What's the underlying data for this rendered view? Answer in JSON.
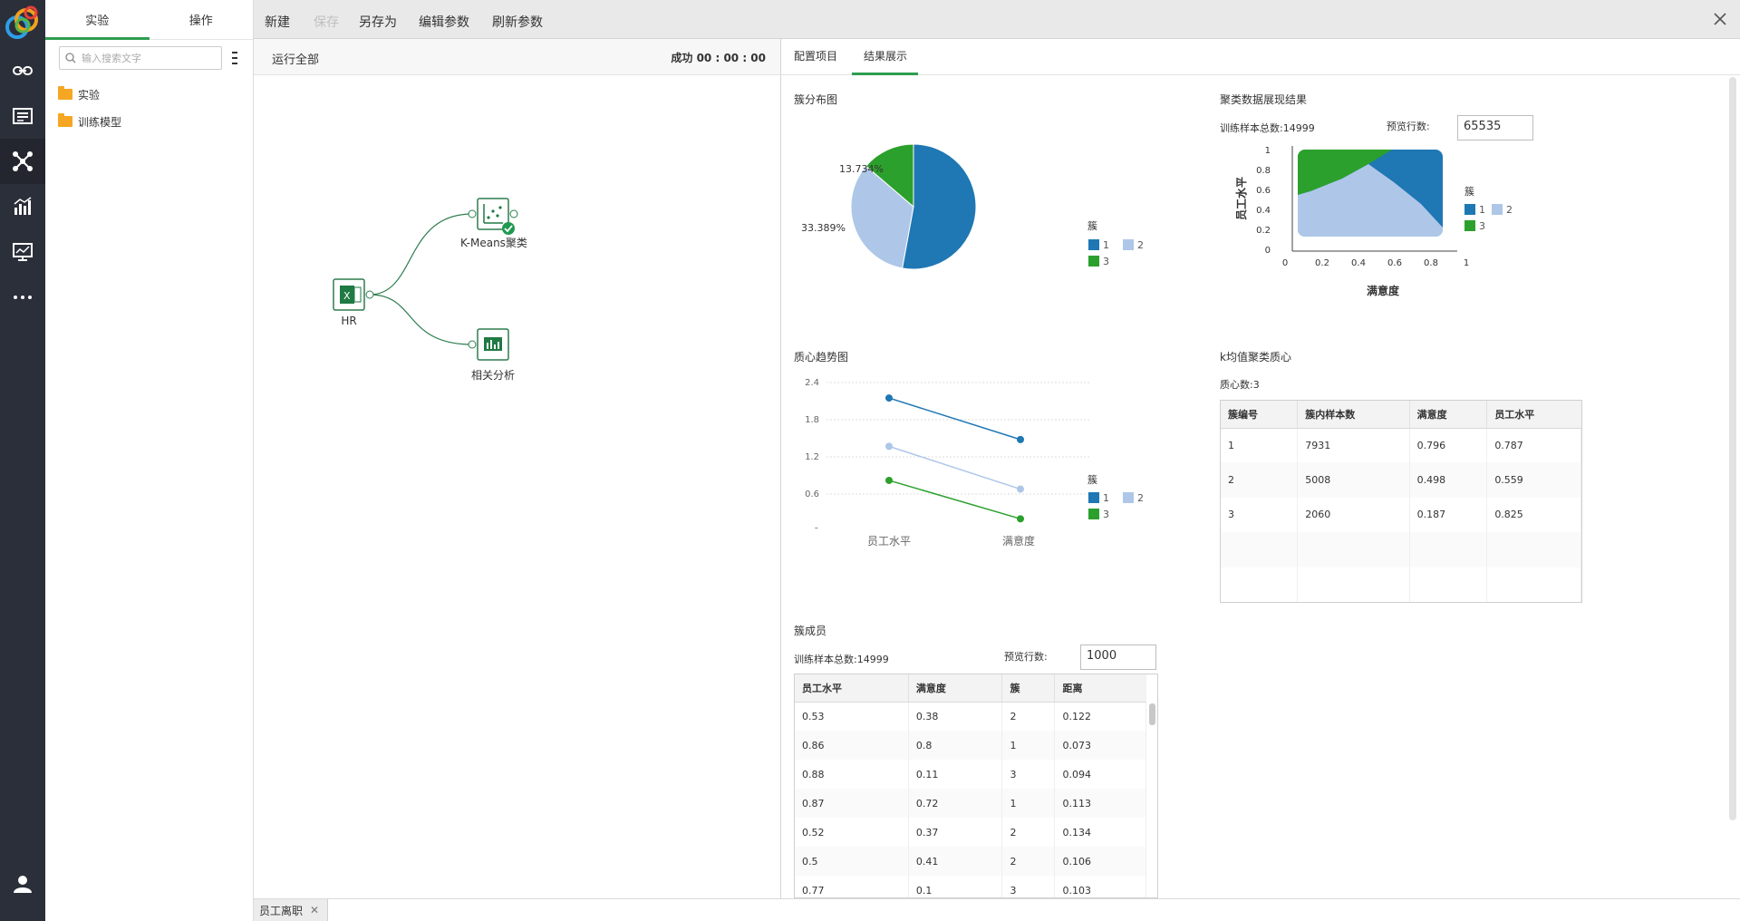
{
  "explorer": {
    "tabs": [
      {
        "label": "实验"
      },
      {
        "label": "操作"
      }
    ],
    "search_placeholder": "输入搜索文字",
    "tree": [
      {
        "label": "实验"
      },
      {
        "label": "训练模型"
      }
    ]
  },
  "toolbar": {
    "new": "新建",
    "save": "保存",
    "save_as": "另存为",
    "edit_params": "编辑参数",
    "refresh_params": "刷新参数"
  },
  "flow": {
    "run_all": "运行全部",
    "status": "成功 00 : 00 : 00",
    "nodes": {
      "hr": "HR",
      "kmeans": "K-Means聚类",
      "corr": "相关分析"
    }
  },
  "results": {
    "tabs": [
      {
        "label": "配置项目"
      },
      {
        "label": "结果展示"
      }
    ],
    "pie": {
      "title": "簇分布图",
      "label_a": "13.734%",
      "label_b": "33.389%",
      "legend_title": "簇",
      "legend": [
        "1",
        "2",
        "3"
      ]
    },
    "scatter": {
      "title": "聚类数据展现结果",
      "samples": "训练样本总数:14999",
      "preview_label": "预览行数:",
      "preview_value": "65535",
      "ylabel": "员工水平",
      "xlabel": "满意度",
      "yticks": [
        "1",
        "0.8",
        "0.6",
        "0.4",
        "0.2",
        "0"
      ],
      "xticks": [
        "0",
        "0.2",
        "0.4",
        "0.6",
        "0.8",
        "1"
      ],
      "legend_title": "簇",
      "legend": [
        "1",
        "2",
        "3"
      ]
    },
    "trend": {
      "title": "质心趋势图",
      "yticks": [
        "2.4",
        "1.8",
        "1.2",
        "0.6",
        "0"
      ],
      "xticks": [
        "员工水平",
        "满意度"
      ],
      "legend_title": "簇",
      "legend": [
        "1",
        "2",
        "3"
      ]
    },
    "centroids": {
      "title": "k均值聚类质心",
      "count": "质心数:3",
      "headers": [
        "簇编号",
        "簇内样本数",
        "满意度",
        "员工水平"
      ],
      "rows": [
        [
          "1",
          "7931",
          "0.796",
          "0.787"
        ],
        [
          "2",
          "5008",
          "0.498",
          "0.559"
        ],
        [
          "3",
          "2060",
          "0.187",
          "0.825"
        ]
      ]
    },
    "members": {
      "title": "簇成员",
      "samples": "训练样本总数:14999",
      "preview_label": "预览行数:",
      "preview_value": "1000",
      "headers": [
        "员工水平",
        "满意度",
        "簇",
        "距离"
      ],
      "rows": [
        [
          "0.53",
          "0.38",
          "2",
          "0.122"
        ],
        [
          "0.86",
          "0.8",
          "1",
          "0.073"
        ],
        [
          "0.88",
          "0.11",
          "3",
          "0.094"
        ],
        [
          "0.87",
          "0.72",
          "1",
          "0.113"
        ],
        [
          "0.52",
          "0.37",
          "2",
          "0.134"
        ],
        [
          "0.5",
          "0.41",
          "2",
          "0.106"
        ],
        [
          "0.77",
          "0.1",
          "3",
          "0.103"
        ]
      ]
    }
  },
  "bottom_tab": {
    "label": "员工离职"
  },
  "colors": {
    "c1": "#1f77b4",
    "c2": "#aec7e8",
    "c3": "#2ca02c",
    "accent": "#2e9e4f"
  },
  "chart_data": [
    {
      "type": "pie",
      "title": "簇分布图",
      "categories": [
        "1",
        "2",
        "3"
      ],
      "values": [
        52.877,
        33.389,
        13.734
      ],
      "legend": "right"
    },
    {
      "type": "line",
      "title": "质心趋势图",
      "categories": [
        "员工水平",
        "满意度"
      ],
      "series": [
        {
          "name": "1",
          "values": [
            2.15,
            1.48
          ]
        },
        {
          "name": "2",
          "values": [
            1.37,
            0.68
          ]
        },
        {
          "name": "3",
          "values": [
            0.82,
            0.2
          ]
        }
      ],
      "ylim": [
        0,
        2.4
      ],
      "legend": "right"
    },
    {
      "type": "scatter",
      "title": "聚类数据展现结果",
      "xlabel": "满意度",
      "ylabel": "员工水平",
      "xlim": [
        0,
        1
      ],
      "ylim": [
        0,
        1
      ],
      "legend": "right"
    }
  ]
}
